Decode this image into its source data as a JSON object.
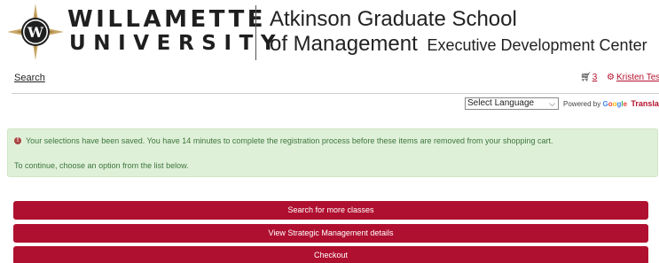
{
  "header": {
    "logo_line1": "WILLAMETTE",
    "logo_line2": "UNIVERSITY",
    "school_line1": "Atkinson Graduate School",
    "school_line2_main": "of Management",
    "school_line2_sub": "Executive Development Center"
  },
  "nav": {
    "search_label": "Search",
    "cart_count": "3",
    "user_name": "Kristen Test"
  },
  "translate": {
    "select_value": "Select Language",
    "powered_by": "Powered by",
    "google": [
      "G",
      "o",
      "o",
      "g",
      "l",
      "e"
    ],
    "translate_label": "Translate"
  },
  "alert": {
    "message": "Your selections have been saved. You have 14 minutes to complete the registration process before these items are removed from your shopping cart.",
    "instruction": "To continue, choose an option from the list below."
  },
  "actions": {
    "search_more": "Search for more classes",
    "view_details": "View Strategic Management details",
    "checkout": "Checkout"
  },
  "colors": {
    "brand_red": "#b01030",
    "link_red": "#b4122e",
    "alert_bg": "#dff0d8",
    "alert_text": "#3c763d"
  }
}
